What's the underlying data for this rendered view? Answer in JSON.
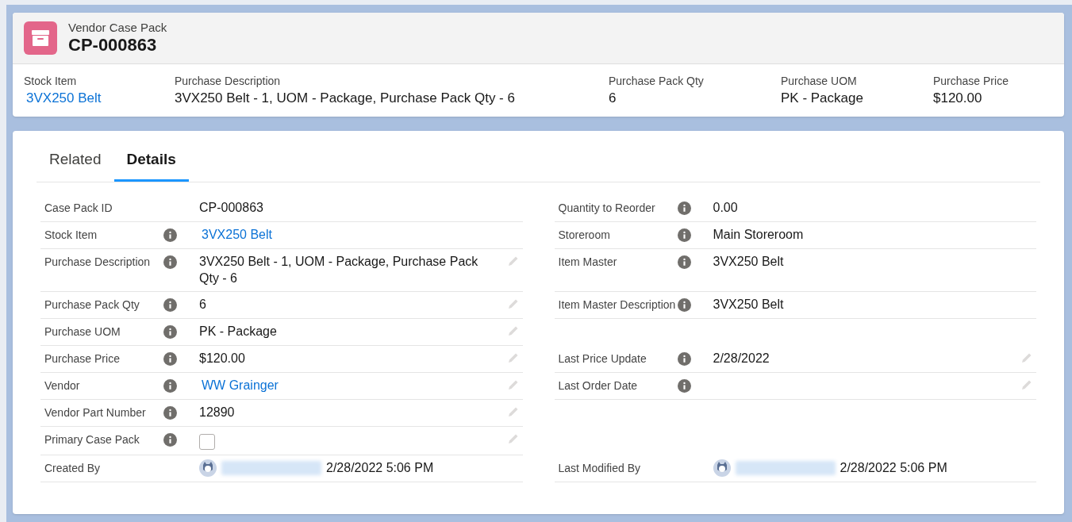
{
  "record": {
    "object_type": "Vendor Case Pack",
    "name": "CP-000863"
  },
  "highlights": [
    {
      "label": "Stock Item",
      "value": "3VX250 Belt",
      "link": true
    },
    {
      "label": "Purchase Description",
      "value": "3VX250 Belt - 1, UOM - Package, Purchase Pack Qty - 6",
      "link": false
    },
    {
      "label": "Purchase Pack Qty",
      "value": "6",
      "link": false
    },
    {
      "label": "Purchase UOM",
      "value": "PK - Package",
      "link": false
    },
    {
      "label": "Purchase Price",
      "value": "$120.00",
      "link": false
    }
  ],
  "tabs": [
    {
      "label": "Related",
      "selected": false
    },
    {
      "label": "Details",
      "selected": true
    }
  ],
  "rows": [
    {
      "left": {
        "kind": "text",
        "label": "Case Pack ID",
        "info": false,
        "value": "CP-000863",
        "link": false,
        "editable": false
      },
      "right": {
        "kind": "text",
        "label": "Quantity to Reorder",
        "info": true,
        "value": "0.00",
        "link": false,
        "editable": false
      }
    },
    {
      "left": {
        "kind": "text",
        "label": "Stock Item",
        "info": true,
        "value": "3VX250 Belt",
        "link": true,
        "editable": false
      },
      "right": {
        "kind": "text",
        "label": "Storeroom",
        "info": true,
        "value": "Main Storeroom",
        "link": false,
        "editable": false
      }
    },
    {
      "left": {
        "kind": "text",
        "label": "Purchase Description",
        "info": true,
        "value": "3VX250 Belt - 1, UOM - Package, Purchase Pack Qty - 6",
        "link": false,
        "editable": true
      },
      "right": {
        "kind": "text",
        "label": "Item Master",
        "info": true,
        "value": "3VX250 Belt",
        "link": false,
        "editable": false
      }
    },
    {
      "left": {
        "kind": "text",
        "label": "Purchase Pack Qty",
        "info": true,
        "value": "6",
        "link": false,
        "editable": true
      },
      "right": {
        "kind": "text",
        "label": "Item Master Description",
        "info": true,
        "value": "3VX250 Belt",
        "link": false,
        "editable": false
      }
    },
    {
      "left": {
        "kind": "text",
        "label": "Purchase UOM",
        "info": true,
        "value": "PK - Package",
        "link": false,
        "editable": true
      }
    },
    {
      "left": {
        "kind": "text",
        "label": "Purchase Price",
        "info": true,
        "value": "$120.00",
        "link": false,
        "editable": true
      },
      "right": {
        "kind": "text",
        "label": "Last Price Update",
        "info": true,
        "value": "2/28/2022",
        "link": false,
        "editable": true
      }
    },
    {
      "left": {
        "kind": "text",
        "label": "Vendor",
        "info": true,
        "value": "WW Grainger",
        "link": true,
        "editable": true
      },
      "right": {
        "kind": "text",
        "label": "Last Order Date",
        "info": true,
        "editable": true
      }
    },
    {
      "left": {
        "kind": "text",
        "label": "Vendor Part Number",
        "info": true,
        "value": "12890",
        "link": false,
        "editable": true
      }
    },
    {
      "left": {
        "kind": "checkbox",
        "label": "Primary Case Pack",
        "info": true,
        "checked": false,
        "editable": true
      }
    },
    {
      "left": {
        "kind": "user",
        "label": "Created By",
        "info": false,
        "timestamp": "2/28/2022 5:06 PM",
        "editable": false
      },
      "right": {
        "kind": "user",
        "label": "Last Modified By",
        "info": false,
        "timestamp": "2/28/2022 5:06 PM",
        "editable": false
      }
    }
  ]
}
